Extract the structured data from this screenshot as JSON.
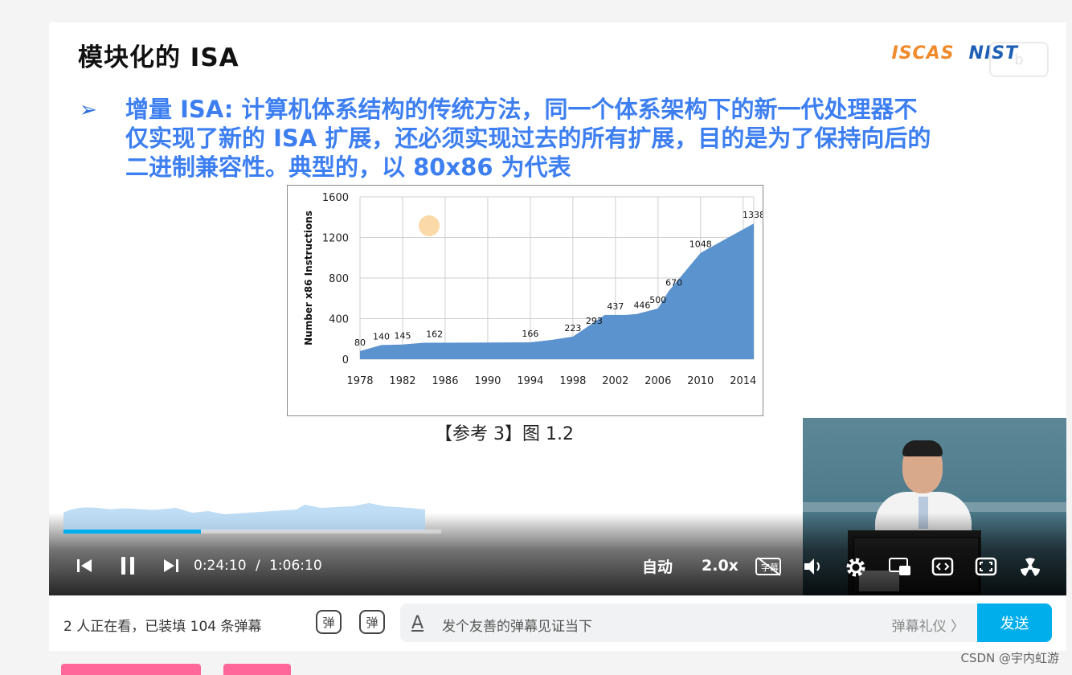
{
  "slide": {
    "title": "模块化的 ISA",
    "logo_left": "ISCAS",
    "logo_right": "NIST",
    "bullet": "➢",
    "text": "增量 ISA: 计算机体系结构的传统方法，同一个体系架构下的新一代处理器不仅实现了新的 ISA 扩展，还必须实现过去的所有扩展，目的是为了保持向后的二进制兼容性。典型的，以 80x86 为代表",
    "caption": "【参考 3】图 1.2"
  },
  "chart_data": {
    "type": "area",
    "ylabel": "Number x86 Instructions",
    "xlabel": "",
    "x_ticks": [
      "1978",
      "1982",
      "1986",
      "1990",
      "1994",
      "1998",
      "2002",
      "2006",
      "2010",
      "2014"
    ],
    "y_ticks": [
      "0",
      "400",
      "800",
      "1200",
      "1600"
    ],
    "ylim": [
      0,
      1600
    ],
    "xlim": [
      1978,
      2015
    ],
    "points": [
      {
        "x": 1978,
        "y": 80
      },
      {
        "x": 1980,
        "y": 140
      },
      {
        "x": 1982,
        "y": 145
      },
      {
        "x": 1984,
        "y": 162
      },
      {
        "x": 1986,
        "y": 162
      },
      {
        "x": 1994,
        "y": 166
      },
      {
        "x": 1996,
        "y": 190
      },
      {
        "x": 1998,
        "y": 223
      },
      {
        "x": 1999,
        "y": 293
      },
      {
        "x": 2001,
        "y": 437
      },
      {
        "x": 2003,
        "y": 437
      },
      {
        "x": 2004,
        "y": 446
      },
      {
        "x": 2006,
        "y": 500
      },
      {
        "x": 2007,
        "y": 670
      },
      {
        "x": 2010,
        "y": 1048
      },
      {
        "x": 2015,
        "y": 1338
      }
    ],
    "labels": [
      {
        "x": 1978,
        "y": 80,
        "text": "80"
      },
      {
        "x": 1980,
        "y": 140,
        "text": "140"
      },
      {
        "x": 1982,
        "y": 145,
        "text": "145"
      },
      {
        "x": 1985,
        "y": 162,
        "text": "162"
      },
      {
        "x": 1994,
        "y": 166,
        "text": "166"
      },
      {
        "x": 1998,
        "y": 223,
        "text": "223"
      },
      {
        "x": 2000,
        "y": 293,
        "text": "293"
      },
      {
        "x": 2002,
        "y": 437,
        "text": "437"
      },
      {
        "x": 2004.5,
        "y": 446,
        "text": "446"
      },
      {
        "x": 2006,
        "y": 500,
        "text": "500"
      },
      {
        "x": 2007.5,
        "y": 670,
        "text": "670"
      },
      {
        "x": 2010,
        "y": 1048,
        "text": "1048"
      },
      {
        "x": 2015,
        "y": 1338,
        "text": "1338"
      }
    ],
    "fill_color": "#5b93cf",
    "grid": true
  },
  "player": {
    "progress": 0.364,
    "current_time": "0:24:10",
    "separator": "/",
    "duration": "1:06:10",
    "quality": "自动",
    "speed": "2.0x",
    "subtitle_icon_text": "字幕"
  },
  "bottom": {
    "viewers": "2 人正在看，已装填 104 条弹幕",
    "danmaku_icon_1": "弹",
    "danmaku_icon_2": "弹",
    "input_prefix": "A",
    "placeholder": "发个友善的弹幕见证当下",
    "etiquette": "弹幕礼仪 〉",
    "send": "发送"
  },
  "watermark": "CSDN @宇内虹游"
}
